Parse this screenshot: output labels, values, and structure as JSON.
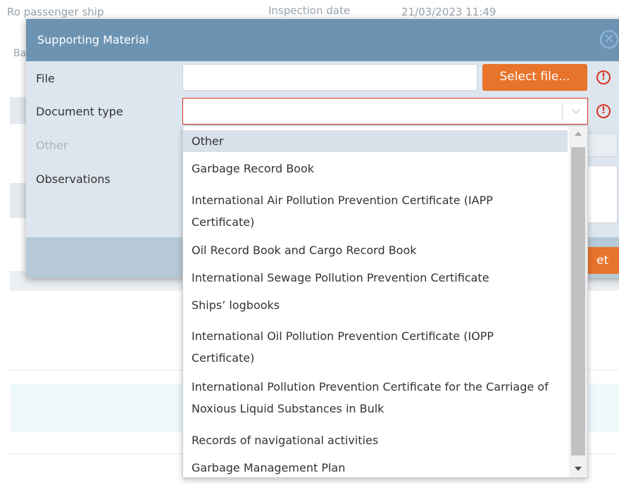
{
  "background": {
    "vessel_type": "Ro passenger ship",
    "inspection_date_label": "Inspection date",
    "inspection_date_value": "21/03/2023 11:49",
    "partial_label": "Ba"
  },
  "modal": {
    "title": "Supporting Material",
    "close_icon": "close-circle-icon",
    "fields": {
      "file_label": "File",
      "file_value": "",
      "select_file_label": "Select file...",
      "document_type_label": "Document type",
      "document_type_value": "",
      "other_label": "Other",
      "observations_label": "Observations"
    },
    "submit_label_partial": "et"
  },
  "dropdown": {
    "options": [
      "Other",
      "Garbage Record Book",
      "International Air Pollution Prevention Certificate (IAPP Certificate)",
      "Oil Record Book and Cargo Record Book",
      "International Sewage Pollution Prevention Certificate",
      "Ships’ logbooks",
      "International Oil Pollution Prevention Certificate (IOPP Certificate)",
      "International Pollution Prevention Certificate for the Carriage of Noxious Liquid Substances in Bulk",
      "Records of navigational activities",
      "Garbage Management Plan"
    ],
    "highlighted": "Other"
  },
  "colors": {
    "accent": "#e8732a",
    "modal_header": "#6d93b2",
    "error": "#d9311f"
  }
}
